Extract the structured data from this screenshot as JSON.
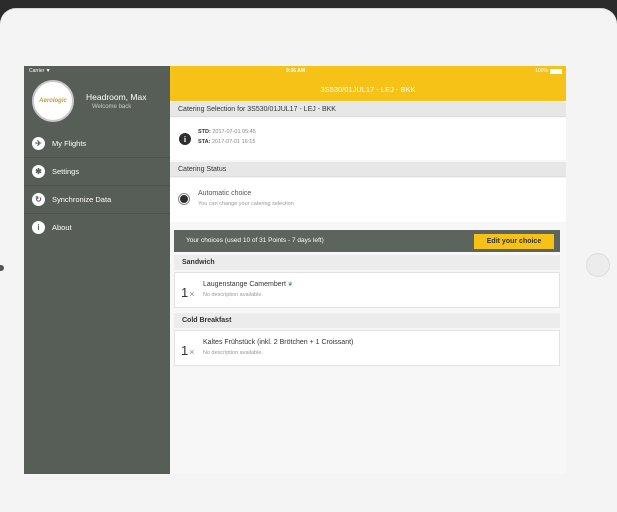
{
  "status_bar": {
    "carrier": "Carrier ▼",
    "time": "9:36 AM",
    "battery": "100%"
  },
  "sidebar": {
    "logo": "Aerologic",
    "user_name": "Headroom, Max",
    "welcome": "Welcome back",
    "items": [
      {
        "label": "My Flights",
        "icon": "airplane-icon",
        "glyph": "✈"
      },
      {
        "label": "Settings",
        "icon": "gear-icon",
        "glyph": "✱"
      },
      {
        "label": "Synchronize Data",
        "icon": "sync-icon",
        "glyph": "↻"
      },
      {
        "label": "About",
        "icon": "info-icon",
        "glyph": "i"
      }
    ]
  },
  "header": {
    "title": "3S530/01JUL17 - LEJ - BKK"
  },
  "catering": {
    "section_title": "Catering Selection for 3S530/01JUL17 - LEJ - BKK",
    "std_label": "STD:",
    "std_value": "2017-07-01 05:45",
    "sta_label": "STA:",
    "sta_value": "2017-07-01 16:15"
  },
  "status": {
    "section_title": "Catering Status",
    "choice_title": "Automatic choice",
    "choice_sub": "You can change your catering selection"
  },
  "choices": {
    "summary": "Your choices (used 10 of 31 Points - 7 days left)",
    "edit_label": "Edit your choice",
    "categories": [
      {
        "title": "Sandwich",
        "items": [
          {
            "qty": "1",
            "name": "Laugenstange Camembert",
            "desc": "No description available."
          }
        ]
      },
      {
        "title": "Cold Breakfast",
        "items": [
          {
            "qty": "1",
            "name": "Kaltes Frühstück (inkl. 2 Brötchen + 1 Croissant)",
            "desc": "No description available."
          }
        ]
      }
    ]
  },
  "colors": {
    "accent": "#f6c218",
    "sidebar": "#575d57",
    "bar": "#5d635d"
  }
}
